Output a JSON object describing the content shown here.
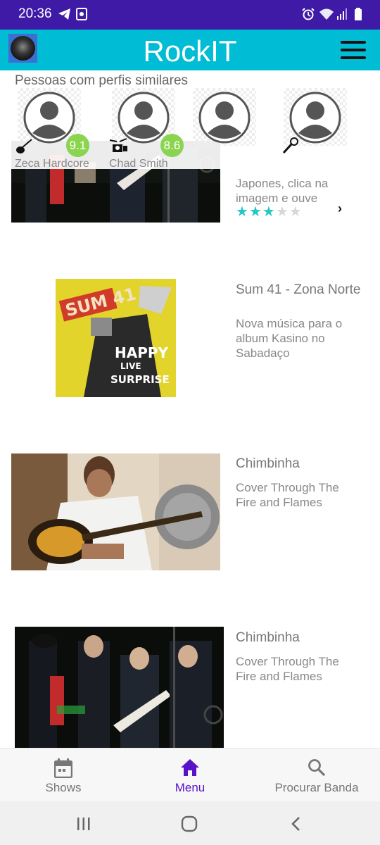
{
  "status_bar": {
    "time": "20:36",
    "left_icons": [
      "telegram-icon",
      "screenshot-icon"
    ],
    "right_icons": [
      "alarm-icon",
      "wifi-icon",
      "signal-icon",
      "battery-icon"
    ]
  },
  "app_bar": {
    "title": "RockIT",
    "avatar": "profile-avatar",
    "menu_icon": "hamburger-menu-icon"
  },
  "similar_profiles": {
    "label": "Pessoas com perfis similares",
    "profiles": [
      {
        "name": "Zeca Hardcore",
        "score": "9.1",
        "instrument_icon": "guitar-icon"
      },
      {
        "name": "Chad Smith",
        "score": "8.6",
        "instrument_icon": "drum-kit-icon"
      },
      {
        "name": "",
        "score": "",
        "instrument_icon": ""
      },
      {
        "name": "",
        "score": "",
        "instrument_icon": "microphone-icon"
      }
    ]
  },
  "feed": {
    "items": [
      {
        "title": "",
        "description": "Japones, clica na imagem e ouve",
        "description_partial_top": "...",
        "rating": 3,
        "rating_max": 5,
        "image": "band-on-stage-photo"
      },
      {
        "title": "Sum 41 - Zona Norte",
        "description": "Nova música para o album Kasino no Sabadaço",
        "image": "sum41-album-cover",
        "cover_text": [
          "SUM 41",
          "HAPPY",
          "LIVE",
          "SURPRISE"
        ]
      },
      {
        "title": "Chimbinha",
        "description": "Cover Through The Fire and Flames",
        "image": "guitarist-photo"
      },
      {
        "title": "Chimbinha",
        "description": "Cover Through The Fire and Flames",
        "image": "band-on-stage-photo"
      }
    ]
  },
  "bottom_nav": {
    "items": [
      {
        "label": "Shows",
        "icon": "calendar-icon",
        "active": false
      },
      {
        "label": "Menu",
        "icon": "home-icon",
        "active": true
      },
      {
        "label": "Procurar Banda",
        "icon": "search-icon",
        "active": false
      }
    ]
  },
  "system_nav": [
    "recents-icon",
    "home-circle-icon",
    "back-icon"
  ],
  "colors": {
    "status_bar": "#3f1aa6",
    "app_bar": "#00bcd4",
    "accent": "#5a12c9",
    "star_on": "#26c6c6",
    "score_badge": "#8bd450"
  }
}
